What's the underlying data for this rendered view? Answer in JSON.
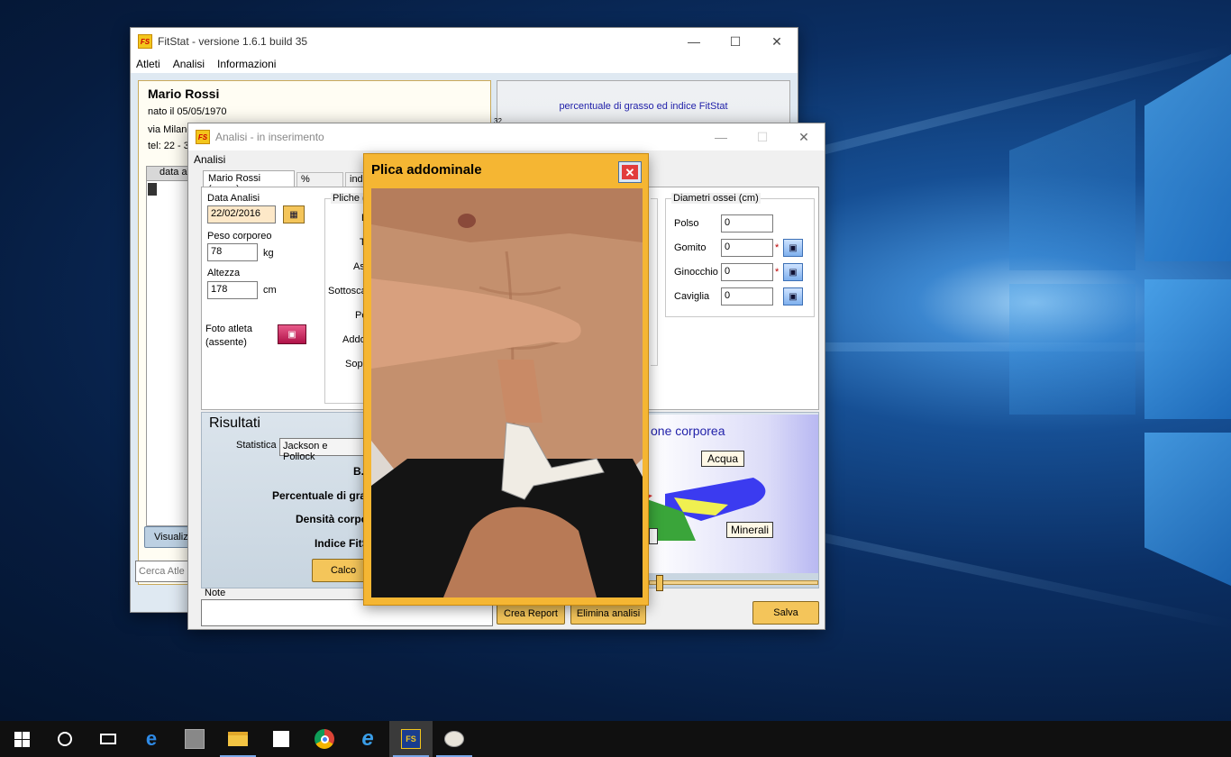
{
  "main_window": {
    "title": "FitStat - versione 1.6.1 build 35",
    "menu": [
      "Atleti",
      "Analisi",
      "Informazioni"
    ],
    "athlete": {
      "name": "Mario Rossi",
      "birth": "nato il 05/05/1970",
      "address": "via Milano",
      "phone": "tel: 22 - 3"
    },
    "grid_header": "data a",
    "chart_title": "percentuale di grasso ed indice FitStat",
    "chart_tick": "32",
    "visualize_button": "Visualiz",
    "search_placeholder": "Cerca Atle"
  },
  "analysis_window": {
    "title": "Analisi - in inserimento",
    "menu": [
      "Analisi"
    ],
    "tabs": [
      "Mario Rossi (uomo)",
      "% grasso",
      "indi"
    ],
    "data_analisi_label": "Data Analisi",
    "data_analisi_value": "22/02/2016",
    "peso_label": "Peso corporeo",
    "peso_value": "78",
    "peso_unit": "kg",
    "altezza_label": "Altezza",
    "altezza_value": "178",
    "altezza_unit": "cm",
    "foto_label": "Foto atleta\n(assente)",
    "pliche_caption": "Pliche (r",
    "pliche_labels": [
      "B",
      "T",
      "As",
      "Sottosca",
      "Pe",
      "Addo",
      "Sopr",
      "I"
    ],
    "diametri_caption": "Diametri ossei (cm)",
    "diametri": [
      {
        "label": "Polso",
        "value": "0"
      },
      {
        "label": "Gomito",
        "value": "0"
      },
      {
        "label": "Ginocchio",
        "value": "0"
      },
      {
        "label": "Caviglia",
        "value": "0"
      }
    ],
    "risultati_title": "Risultati",
    "statistica_label": "Statistica",
    "statistica_value": "Jackson e Pollock",
    "result_labels": [
      "B.I",
      "Percentuale di gra",
      "Densità corpo",
      "Indice FitS"
    ],
    "calc_button": "Calco",
    "composition_title": "one corporea",
    "pie_labels": {
      "acqua": "Acqua",
      "minerali": "Minerali"
    },
    "note_label": "Note",
    "crea_report": "Crea Report",
    "elimina_analisi": "Elimina analisi",
    "salva": "Salva"
  },
  "popup": {
    "title": "Plica addominale"
  },
  "colors": {
    "popup_frame": "#f5b633",
    "button": "#f4c55a",
    "pie_blue": "#3b3bf0",
    "pie_green": "#3aa53a",
    "pie_yellow": "#f0f050"
  },
  "taskbar_icons": [
    "windows-start-icon",
    "cortana-circle-icon",
    "task-view-icon",
    "edge-icon",
    "app-gray-icon",
    "file-explorer-icon",
    "store-icon",
    "chrome-icon",
    "internet-explorer-icon",
    "fitstat-icon",
    "paint-icon"
  ]
}
